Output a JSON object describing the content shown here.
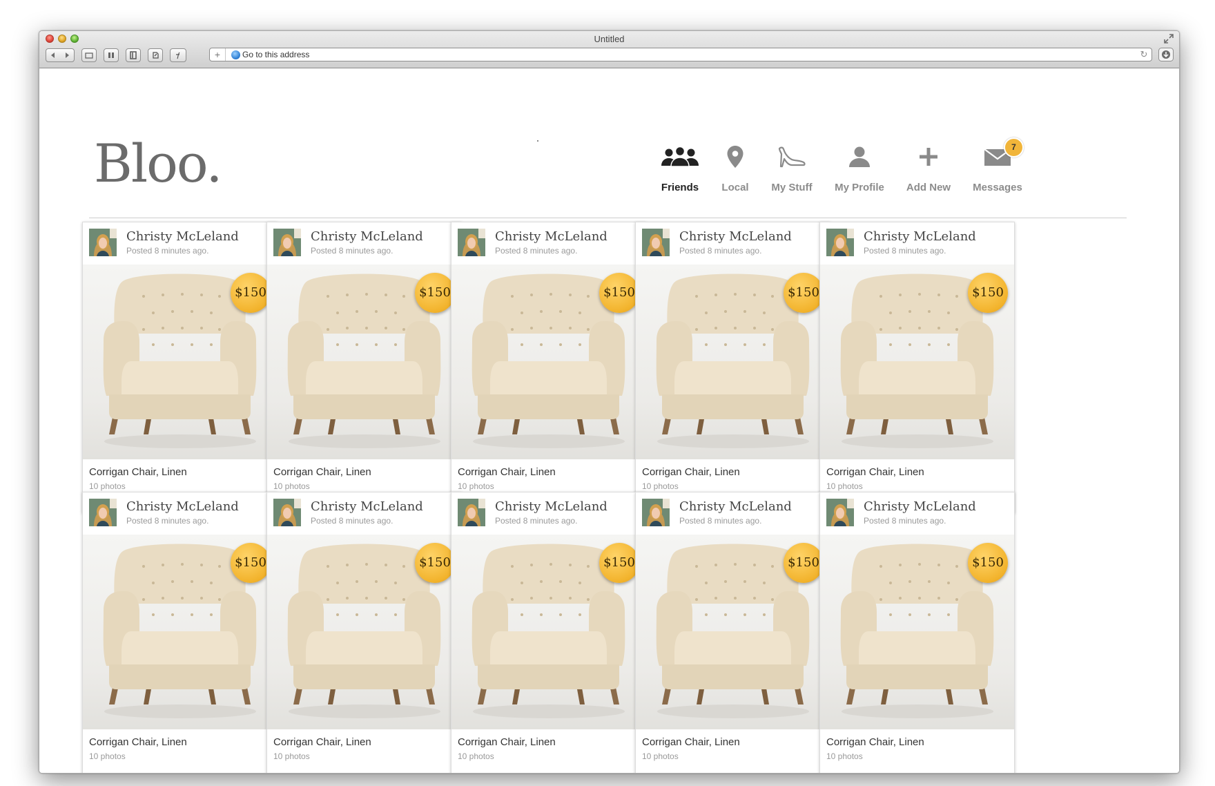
{
  "browser": {
    "window_title": "Untitled",
    "address_placeholder": "Go to this address"
  },
  "app": {
    "logo": "Bloo.",
    "nav": [
      {
        "label": "Friends",
        "icon": "friends-icon",
        "active": true
      },
      {
        "label": "Local",
        "icon": "map-pin-icon",
        "active": false
      },
      {
        "label": "My Stuff",
        "icon": "high-heel-icon",
        "active": false
      },
      {
        "label": "My Profile",
        "icon": "person-icon",
        "active": false
      },
      {
        "label": "Add New",
        "icon": "plus-icon",
        "active": false
      },
      {
        "label": "Messages",
        "icon": "envelope-icon",
        "active": false,
        "badge": "7"
      }
    ]
  },
  "colors": {
    "price_badge": "#f2b32c",
    "message_badge": "#f1b53a",
    "logo": "#6b6b6b"
  },
  "listings": [
    {
      "author": "Christy McLeland",
      "posted": "Posted 8 minutes ago.",
      "price": "$150",
      "title": "Corrigan Chair, Linen",
      "photos": "10 photos"
    },
    {
      "author": "Christy McLeland",
      "posted": "Posted 8 minutes ago.",
      "price": "$150",
      "title": "Corrigan Chair, Linen",
      "photos": "10 photos"
    },
    {
      "author": "Christy McLeland",
      "posted": "Posted 8 minutes ago.",
      "price": "$150",
      "title": "Corrigan Chair, Linen",
      "photos": "10 photos"
    },
    {
      "author": "Christy McLeland",
      "posted": "Posted 8 minutes ago.",
      "price": "$150",
      "title": "Corrigan Chair, Linen",
      "photos": "10 photos"
    },
    {
      "author": "Christy McLeland",
      "posted": "Posted 8 minutes ago.",
      "price": "$150",
      "title": "Corrigan Chair, Linen",
      "photos": "10 photos"
    },
    {
      "author": "Christy McLeland",
      "posted": "Posted 8 minutes ago.",
      "price": "$150",
      "title": "Corrigan Chair, Linen",
      "photos": "10 photos"
    },
    {
      "author": "Christy McLeland",
      "posted": "Posted 8 minutes ago.",
      "price": "$150",
      "title": "Corrigan Chair, Linen",
      "photos": "10 photos"
    },
    {
      "author": "Christy McLeland",
      "posted": "Posted 8 minutes ago.",
      "price": "$150",
      "title": "Corrigan Chair, Linen",
      "photos": "10 photos"
    },
    {
      "author": "Christy McLeland",
      "posted": "Posted 8 minutes ago.",
      "price": "$150",
      "title": "Corrigan Chair, Linen",
      "photos": "10 photos"
    },
    {
      "author": "Christy McLeland",
      "posted": "Posted 8 minutes ago.",
      "price": "$150",
      "title": "Corrigan Chair, Linen",
      "photos": "10 photos"
    }
  ]
}
